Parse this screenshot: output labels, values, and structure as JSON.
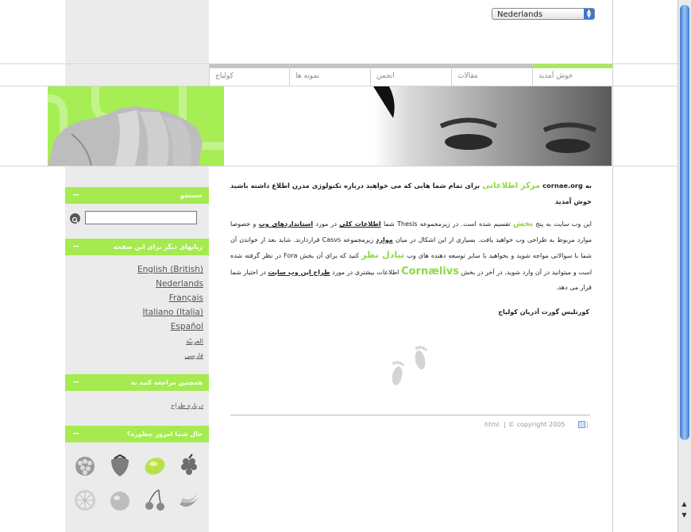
{
  "language_select": {
    "value": "Nederlands"
  },
  "nav": {
    "tabs": [
      {
        "label": "خوش آمدید",
        "active": true
      },
      {
        "label": "مقالات"
      },
      {
        "label": "انجمن"
      },
      {
        "label": "نمونه ها"
      },
      {
        "label": "کولیاج"
      }
    ]
  },
  "sidebar": {
    "search_title": "جستجو",
    "languages_title": "زبانهای دیگر برای این صفحه",
    "languages": [
      "English (British)",
      "Nederlands",
      "Français",
      "Italiano (Italia)",
      "Español",
      "العربيّة",
      "فارسی"
    ],
    "also_title": "همچنین مراجعه کنید به",
    "also_link": "درباره طراح",
    "mood_title": "حال شما امروز چطوره؟",
    "fruit_icons": [
      "raspberry-icon",
      "strawberry-icon",
      "lemon-icon",
      "grapes-icon",
      "orange-slice-icon",
      "peach-icon",
      "cherries-icon",
      "bananas-icon"
    ]
  },
  "content": {
    "intro_1": "به",
    "intro_site": "cornae.org",
    "intro_green": "مرکز اطلاعاتی",
    "intro_2": "برای تمام شما هایی که می خواهید درباره تکنولوژی مدرن اطلاع داشته باشید خوش آمدید",
    "p1": "این وب سایت به پنج",
    "p1_green": "بخش",
    "p2": "تقسیم شده است.   در زیرمجموعه Thesis شما",
    "p2_link": "اطلاعات کلی",
    "p3": "در مورد",
    "p3_link": "استانداردهای وب",
    "p4": "و خصوصا موارد مربوط به طراحی وب خواهید یافت. بسیاری از این اشکال در میان",
    "p4_link": "موارد",
    "p5": "زیرمجموعه Casvs قراردارند. شاید بعد از خواندن آن شما با سوالاتی مواجه شوید و بخواهید با سایر توسعه دهنده های وب",
    "p5_green": "تبادل نظر",
    "p6": "کنید که برای آن بخش Fora در نظر گرفته شده است و میتوانید در آن وارد شوید. در آخر در بخش",
    "p6_green": "Cornælivs",
    "p7": "اطلاعات بیشتری در مورد",
    "p7_link": "طراح این وب سایت",
    "p8": "در اختیار شما قرار می دهد.",
    "signature": "کورنلیس گورت آدریان کولیاج"
  },
  "footer": {
    "html": "html",
    "copyright": "© copyright 2005"
  },
  "colors": {
    "accent": "#a5eb4f",
    "text_green": "#8dd93f",
    "sidebar_bg": "#ebebeb"
  }
}
